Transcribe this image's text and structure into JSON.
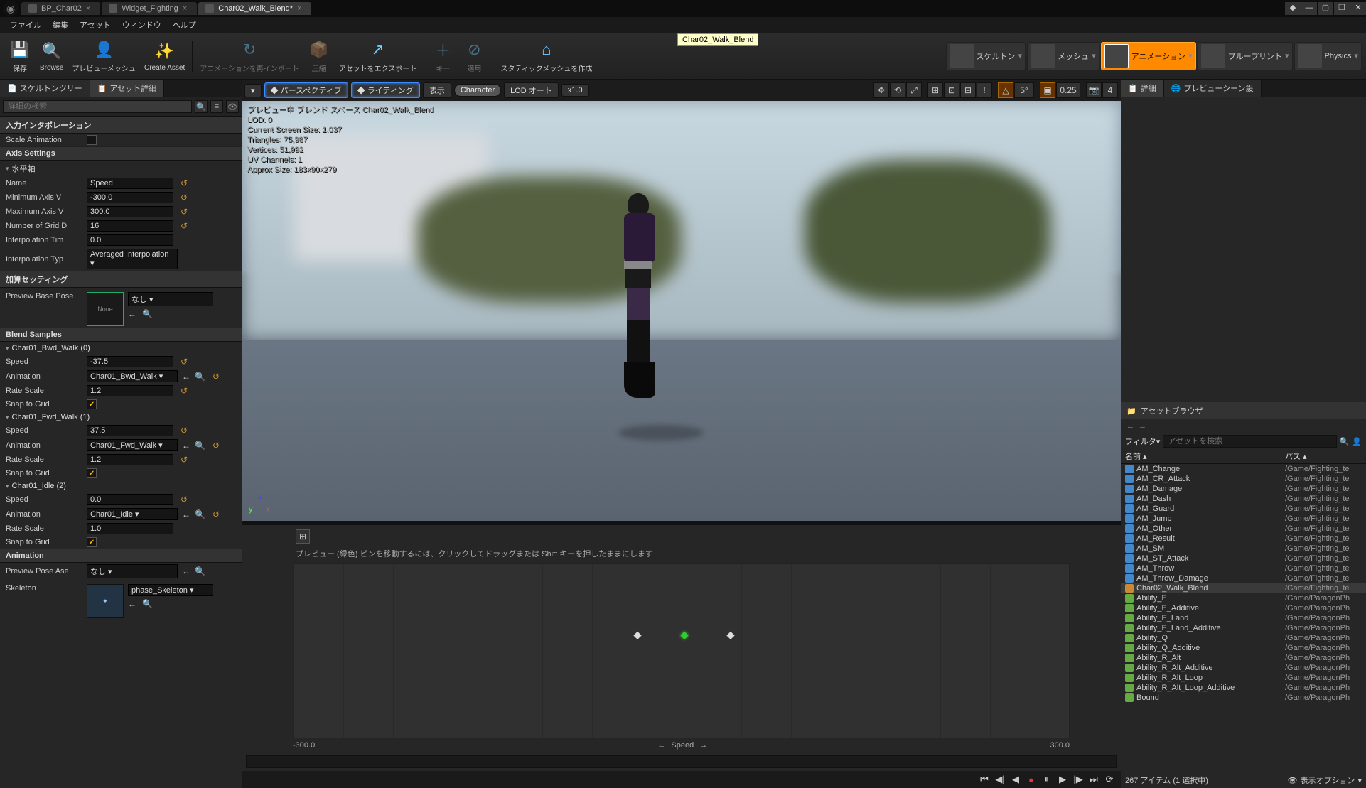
{
  "window": {
    "tooltip": "Char02_Walk_Blend"
  },
  "tabs": [
    {
      "label": "BP_Char02"
    },
    {
      "label": "Widget_Fighting"
    },
    {
      "label": "Char02_Walk_Blend*"
    }
  ],
  "menu": [
    "ファイル",
    "編集",
    "アセット",
    "ウィンドウ",
    "ヘルプ"
  ],
  "toolbar": [
    {
      "label": "保存",
      "icon": "💾"
    },
    {
      "label": "Browse",
      "icon": "🔍"
    },
    {
      "label": "プレビューメッシュ",
      "icon": "👤"
    },
    {
      "label": "Create Asset",
      "icon": "✨"
    },
    {
      "label": "アニメーションを再インポート",
      "icon": "↻",
      "dim": true
    },
    {
      "label": "圧縮",
      "icon": "📦",
      "dim": true
    },
    {
      "label": "アセットをエクスポート",
      "icon": "↗"
    },
    {
      "label": "キー",
      "icon": "＋",
      "dim": true
    },
    {
      "label": "適用",
      "icon": "⊘",
      "dim": true
    },
    {
      "label": "スタティックメッシュを作成",
      "icon": "⌂"
    }
  ],
  "modes": [
    {
      "label": "スケルトン"
    },
    {
      "label": "メッシュ"
    },
    {
      "label": "アニメーション",
      "active": true
    },
    {
      "label": "ブループリント"
    },
    {
      "label": "Physics"
    }
  ],
  "leftTabs": [
    {
      "label": "スケルトンツリー"
    },
    {
      "label": "アセット詳細",
      "active": true
    }
  ],
  "search": {
    "placeholder": "詳細の検索"
  },
  "sections": {
    "inputInterp": "入力インタポレーション",
    "scaleAnimLabel": "Scale Animation",
    "axisSettings": "Axis Settings",
    "horizAxis": "水平軸",
    "nameLabel": "Name",
    "nameVal": "Speed",
    "minAxisLabel": "Minimum Axis V",
    "minAxisVal": "-300.0",
    "maxAxisLabel": "Maximum Axis V",
    "maxAxisVal": "300.0",
    "gridLabel": "Number of Grid D",
    "gridVal": "16",
    "interpTimeLabel": "Interpolation Tim",
    "interpTimeVal": "0.0",
    "interpTypeLabel": "Interpolation Typ",
    "interpTypeVal": "Averaged Interpolation",
    "additive": "加算セッティング",
    "previewBaseLabel": "Preview Base Pose",
    "previewBaseVal": "なし",
    "noneLabel": "None",
    "blendSamples": "Blend Samples",
    "bs0": {
      "title": "Char01_Bwd_Walk (0)",
      "speed": "-37.5",
      "anim": "Char01_Bwd_Walk",
      "rate": "1.2"
    },
    "bs1": {
      "title": "Char01_Fwd_Walk (1)",
      "speed": "37.5",
      "anim": "Char01_Fwd_Walk",
      "rate": "1.2"
    },
    "bs2": {
      "title": "Char01_Idle (2)",
      "speed": "0.0",
      "anim": "Char01_Idle",
      "rate": "1.0"
    },
    "speedLabel": "Speed",
    "animLabel": "Animation",
    "rateLabel": "Rate Scale",
    "snapLabel": "Snap to Grid",
    "animation": "Animation",
    "previewPoseLabel": "Preview Pose Ase",
    "previewPoseVal": "なし",
    "skeletonLabel": "Skeleton",
    "skeletonVal": "phase_Skeleton"
  },
  "viewport": {
    "buttons": {
      "perspective": "パースペクティブ",
      "lighting": "ライティング",
      "show": "表示",
      "character": "Character",
      "lod": "LOD オート",
      "speed": "x1.0"
    },
    "iconvals": {
      "angle": "5°",
      "step": "0.25"
    },
    "overlay": [
      "プレビュー中 ブレンド スペース Char02_Walk_Blend",
      "LOD: 0",
      "Current Screen Size: 1.037",
      "Triangles: 75,987",
      "Vertices: 51,992",
      "UV Channels: 1",
      "Approx Size: 183x90x279"
    ]
  },
  "blendspace": {
    "hint": "プレビュー (緑色) ピンを移動するには、クリックしてドラッグまたは Shift キーを押したままにします",
    "axisLabel": "Speed",
    "min": "-300.0",
    "max": "300.0"
  },
  "rightTabs": [
    {
      "label": "詳細"
    },
    {
      "label": "プレビューシーン設"
    }
  ],
  "assetBrowser": {
    "title": "アセットブラウザ",
    "filter": "フィルタ",
    "searchPlaceholder": "アセットを検索",
    "colName": "名前",
    "colPath": "パス",
    "items": [
      {
        "n": "AM_Change",
        "p": "/Game/Fighting_te",
        "c": "blue"
      },
      {
        "n": "AM_CR_Attack",
        "p": "/Game/Fighting_te",
        "c": "blue"
      },
      {
        "n": "AM_Damage",
        "p": "/Game/Fighting_te",
        "c": "blue"
      },
      {
        "n": "AM_Dash",
        "p": "/Game/Fighting_te",
        "c": "blue"
      },
      {
        "n": "AM_Guard",
        "p": "/Game/Fighting_te",
        "c": "blue"
      },
      {
        "n": "AM_Jump",
        "p": "/Game/Fighting_te",
        "c": "blue"
      },
      {
        "n": "AM_Other",
        "p": "/Game/Fighting_te",
        "c": "blue"
      },
      {
        "n": "AM_Result",
        "p": "/Game/Fighting_te",
        "c": "blue"
      },
      {
        "n": "AM_SM",
        "p": "/Game/Fighting_te",
        "c": "blue"
      },
      {
        "n": "AM_ST_Attack",
        "p": "/Game/Fighting_te",
        "c": "blue"
      },
      {
        "n": "AM_Throw",
        "p": "/Game/Fighting_te",
        "c": "blue"
      },
      {
        "n": "AM_Throw_Damage",
        "p": "/Game/Fighting_te",
        "c": "blue"
      },
      {
        "n": "Char02_Walk_Blend",
        "p": "/Game/Fighting_te",
        "c": "orange",
        "sel": true
      },
      {
        "n": "Ability_E",
        "p": "/Game/ParagonPh",
        "c": "green"
      },
      {
        "n": "Ability_E_Additive",
        "p": "/Game/ParagonPh",
        "c": "green"
      },
      {
        "n": "Ability_E_Land",
        "p": "/Game/ParagonPh",
        "c": "green"
      },
      {
        "n": "Ability_E_Land_Additive",
        "p": "/Game/ParagonPh",
        "c": "green"
      },
      {
        "n": "Ability_Q",
        "p": "/Game/ParagonPh",
        "c": "green"
      },
      {
        "n": "Ability_Q_Additive",
        "p": "/Game/ParagonPh",
        "c": "green"
      },
      {
        "n": "Ability_R_Alt",
        "p": "/Game/ParagonPh",
        "c": "green"
      },
      {
        "n": "Ability_R_Alt_Additive",
        "p": "/Game/ParagonPh",
        "c": "green"
      },
      {
        "n": "Ability_R_Alt_Loop",
        "p": "/Game/ParagonPh",
        "c": "green"
      },
      {
        "n": "Ability_R_Alt_Loop_Additive",
        "p": "/Game/ParagonPh",
        "c": "green"
      },
      {
        "n": "Bound",
        "p": "/Game/ParagonPh",
        "c": "green"
      }
    ],
    "status": "267 アイテム (1 選択中)",
    "viewOpt": "表示オプション"
  }
}
